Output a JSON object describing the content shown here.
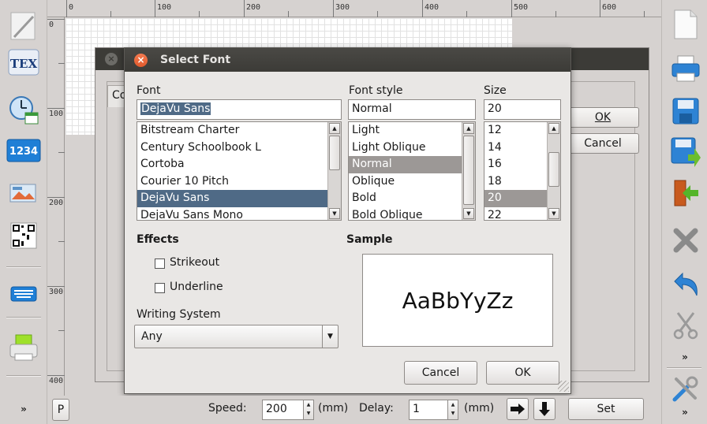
{
  "ruler": {
    "top_labels": [
      "0",
      "100",
      "200",
      "300",
      "400",
      "500",
      "600"
    ],
    "left_labels": [
      "0",
      "100",
      "200",
      "300",
      "400"
    ]
  },
  "left_toolbar": {
    "items": [
      {
        "name": "pencil-icon"
      },
      {
        "name": "tex-icon",
        "text": "TEX"
      },
      {
        "name": "clock-calendar-icon"
      },
      {
        "name": "number-field-icon",
        "text": "1234"
      },
      {
        "name": "image-icon"
      },
      {
        "name": "barcode-icon"
      },
      {
        "name": "keyboard-icon"
      },
      {
        "name": "printer-icon"
      }
    ],
    "more_label": "»",
    "p_button": "P"
  },
  "right_toolbar": {
    "items": [
      {
        "name": "new-document-icon"
      },
      {
        "name": "printer-icon"
      },
      {
        "name": "save-icon"
      },
      {
        "name": "save-as-icon"
      },
      {
        "name": "exit-icon"
      },
      {
        "name": "delete-icon"
      },
      {
        "name": "undo-icon"
      },
      {
        "name": "cut-icon"
      }
    ],
    "more_label": "»",
    "more_label_2": "»"
  },
  "background_dialog": {
    "tab_label": "Co",
    "ok_label": "OK",
    "cancel_label": "Cancel"
  },
  "font_dialog": {
    "title": "Select Font",
    "font_label": "Font",
    "font_style_label": "Font style",
    "size_label": "Size",
    "font_value": "DejaVu Sans",
    "style_value": "Normal",
    "size_value": "20",
    "font_list": [
      "Bitstream Charter",
      "Century Schoolbook L",
      "Cortoba",
      "Courier 10 Pitch",
      "DejaVu Sans",
      "DejaVu Sans Mono"
    ],
    "font_list_selected": 4,
    "style_list": [
      "Light",
      "Light Oblique",
      "Normal",
      "Oblique",
      "Bold",
      "Bold Oblique"
    ],
    "style_list_selected": 2,
    "size_list": [
      "12",
      "14",
      "16",
      "18",
      "20",
      "22"
    ],
    "size_list_selected": 4,
    "effects_label": "Effects",
    "strikeout_label": "Strikeout",
    "underline_label": "Underline",
    "sample_label": "Sample",
    "sample_text": "AaBbYyZz",
    "writing_system_label": "Writing System",
    "writing_system_value": "Any",
    "cancel_label": "Cancel",
    "ok_label": "OK"
  },
  "bottom_bar": {
    "speed_label": "Speed:",
    "speed_value": "200",
    "speed_unit": "(mm)",
    "delay_label": "Delay:",
    "delay_value": "1",
    "delay_unit": "(mm)",
    "set_label": "Set"
  }
}
